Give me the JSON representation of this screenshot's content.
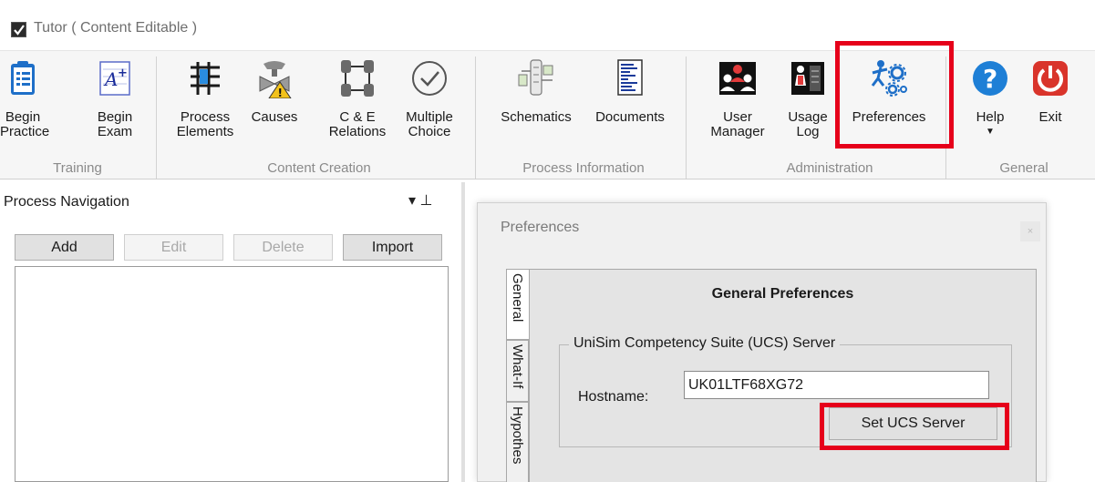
{
  "window": {
    "title": "Tutor ( Content Editable )"
  },
  "ribbon": {
    "buttons": [
      {
        "id": "begin-practice",
        "label": "Begin\nPractice"
      },
      {
        "id": "begin-exam",
        "label": "Begin\nExam"
      },
      {
        "id": "process-elements",
        "label": "Process\nElements"
      },
      {
        "id": "causes",
        "label": "Causes"
      },
      {
        "id": "ce-relations",
        "label": "C & E\nRelations"
      },
      {
        "id": "multiple-choice",
        "label": "Multiple\nChoice"
      },
      {
        "id": "schematics",
        "label": "Schematics"
      },
      {
        "id": "documents",
        "label": "Documents"
      },
      {
        "id": "user-manager",
        "label": "User\nManager"
      },
      {
        "id": "usage-log",
        "label": "Usage\nLog"
      },
      {
        "id": "preferences",
        "label": "Preferences"
      },
      {
        "id": "help",
        "label": "Help"
      },
      {
        "id": "exit",
        "label": "Exit"
      }
    ],
    "groups": {
      "training": "Training",
      "content_creation": "Content Creation",
      "process_information": "Process Information",
      "administration": "Administration",
      "general": "General"
    },
    "icons": [
      "clipboard-icon",
      "grade-a-plus-icon",
      "process-grid-icon",
      "valve-warning-icon",
      "cause-effect-icon",
      "check-circle-icon",
      "schematic-icon",
      "document-icon",
      "users-icon",
      "usage-log-icon",
      "preferences-gears-icon",
      "help-icon",
      "power-icon"
    ]
  },
  "left_pane": {
    "title": "Process Navigation",
    "pin_glyph": "▾ ⊥",
    "buttons": {
      "add": "Add",
      "edit": "Edit",
      "delete": "Delete",
      "import": "Import"
    }
  },
  "dialog": {
    "title": "Preferences",
    "close": "×",
    "tabs": [
      "General",
      "What-If",
      "Hypothes"
    ],
    "panel_title": "General Preferences",
    "group_title": "UniSim Competency Suite (UCS) Server",
    "hostname_label": "Hostname:",
    "hostname_value": "UK01LTF68XG72",
    "set_button": "Set UCS Server"
  },
  "colors": {
    "highlight": "#e6001a",
    "help_blue": "#1e7fd6",
    "exit_red": "#d9342b"
  }
}
